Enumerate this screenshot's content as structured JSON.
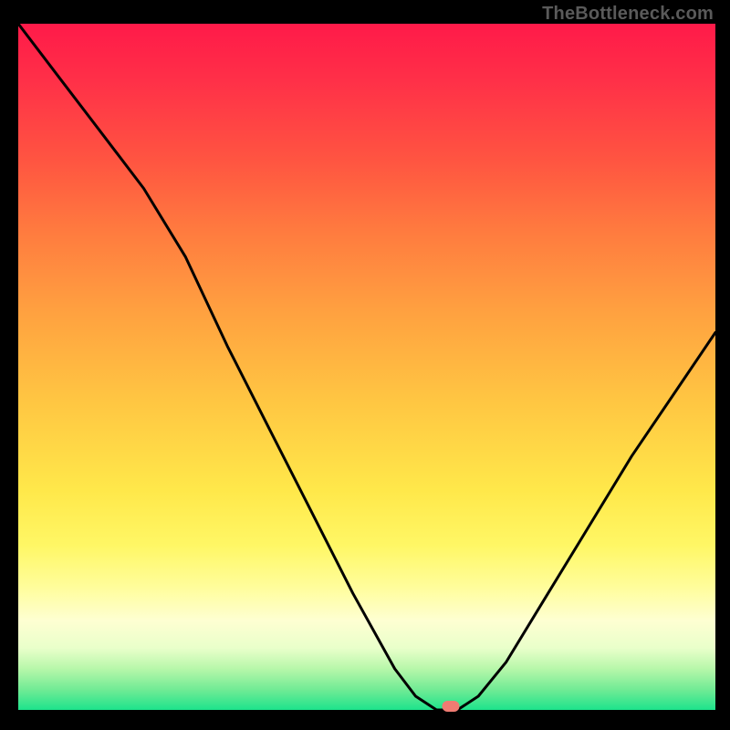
{
  "watermark": "TheBottleneck.com",
  "chart_data": {
    "type": "line",
    "title": "",
    "xlabel": "",
    "ylabel": "",
    "xlim": [
      0,
      100
    ],
    "ylim": [
      0,
      100
    ],
    "grid": false,
    "legend": false,
    "series": [
      {
        "name": "bottleneck-curve",
        "x": [
          0,
          6,
          12,
          18,
          24,
          30,
          36,
          42,
          48,
          54,
          57,
          60,
          63,
          66,
          70,
          76,
          82,
          88,
          94,
          100
        ],
        "y": [
          100,
          92,
          84,
          76,
          66,
          53,
          41,
          29,
          17,
          6,
          2,
          0,
          0,
          2,
          7,
          17,
          27,
          37,
          46,
          55
        ]
      }
    ],
    "marker": {
      "x": 62,
      "y": 0.5,
      "color": "#ef7b72"
    },
    "background_gradient": {
      "direction": "vertical",
      "stops": [
        {
          "pos": 0,
          "color": "#ff1a49"
        },
        {
          "pos": 20,
          "color": "#ff5541"
        },
        {
          "pos": 42,
          "color": "#ffa140"
        },
        {
          "pos": 68,
          "color": "#ffe84a"
        },
        {
          "pos": 87,
          "color": "#feffd2"
        },
        {
          "pos": 100,
          "color": "#1de38c"
        }
      ]
    }
  }
}
